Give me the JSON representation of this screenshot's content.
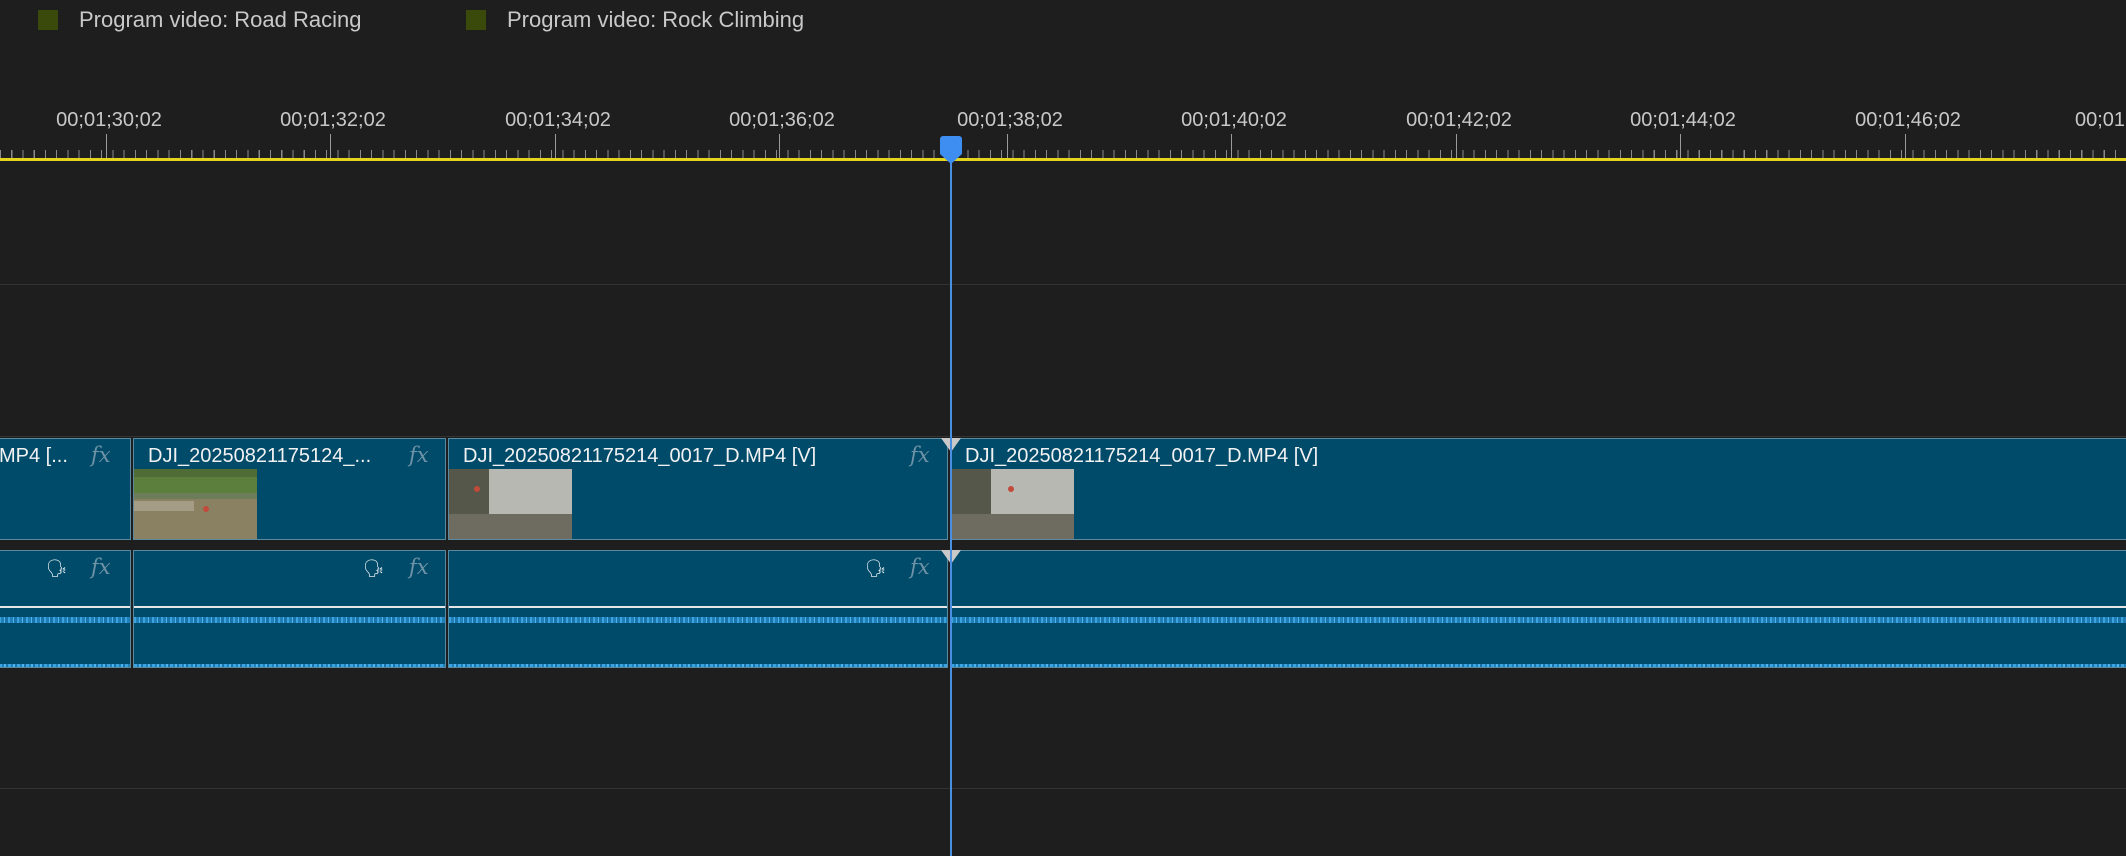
{
  "legend": [
    {
      "label": "Program video: Road Racing",
      "color": "#3a4a0a"
    },
    {
      "label": "Program video: Rock Climbing",
      "color": "#3a4a0a"
    }
  ],
  "ruler": {
    "timecodes": [
      "00;01;30;02",
      "00;01;32;02",
      "00;01;34;02",
      "00;01;36;02",
      "00;01;38;02",
      "00;01;40;02",
      "00;01;42;02",
      "00;01;44;02",
      "00;01;46;02",
      "00;01"
    ]
  },
  "video_clips": [
    {
      "title": "MP4 [..."
    },
    {
      "title": "DJI_20250821175124_..."
    },
    {
      "title": "DJI_20250821175214_0017_D.MP4 [V]"
    },
    {
      "title": "DJI_20250821175214_0017_D.MP4 [V]"
    }
  ],
  "fx_label": "fx",
  "colors": {
    "clip": "#004b6a",
    "work_area_bar": "#e5d41d",
    "playhead": "#3d8ef0",
    "waveform": "#3aa3e0"
  }
}
